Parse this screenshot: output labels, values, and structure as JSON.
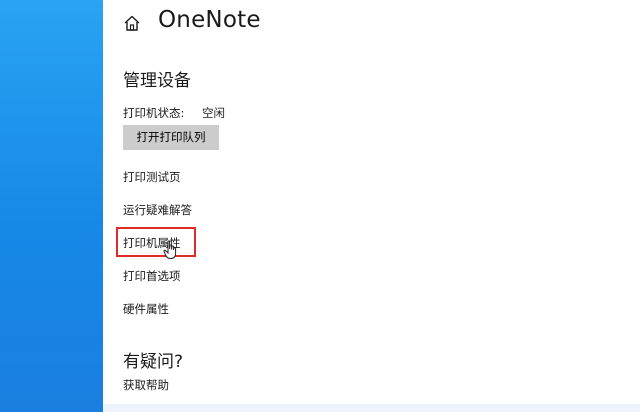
{
  "header": {
    "title": "OneNote",
    "home_icon": "home-icon"
  },
  "manage": {
    "title": "管理设备",
    "status_label": "打印机状态:",
    "status_value": "空闲",
    "open_queue_label": "打开打印队列"
  },
  "links": {
    "test_page": "打印测试页",
    "troubleshoot": "运行疑难解答",
    "printer_properties": "打印机属性",
    "printing_preferences": "打印首选项",
    "hardware_properties": "硬件属性"
  },
  "help": {
    "title": "有疑问?",
    "get_help": "获取帮助"
  },
  "annotation": {
    "highlight_color": "#e02b2b",
    "cursor_icon": "hand-pointer-icon"
  },
  "colors": {
    "desktop_blue": "#1e90e8",
    "panel_bg": "#ffffff",
    "button_bg": "#cccccc"
  }
}
